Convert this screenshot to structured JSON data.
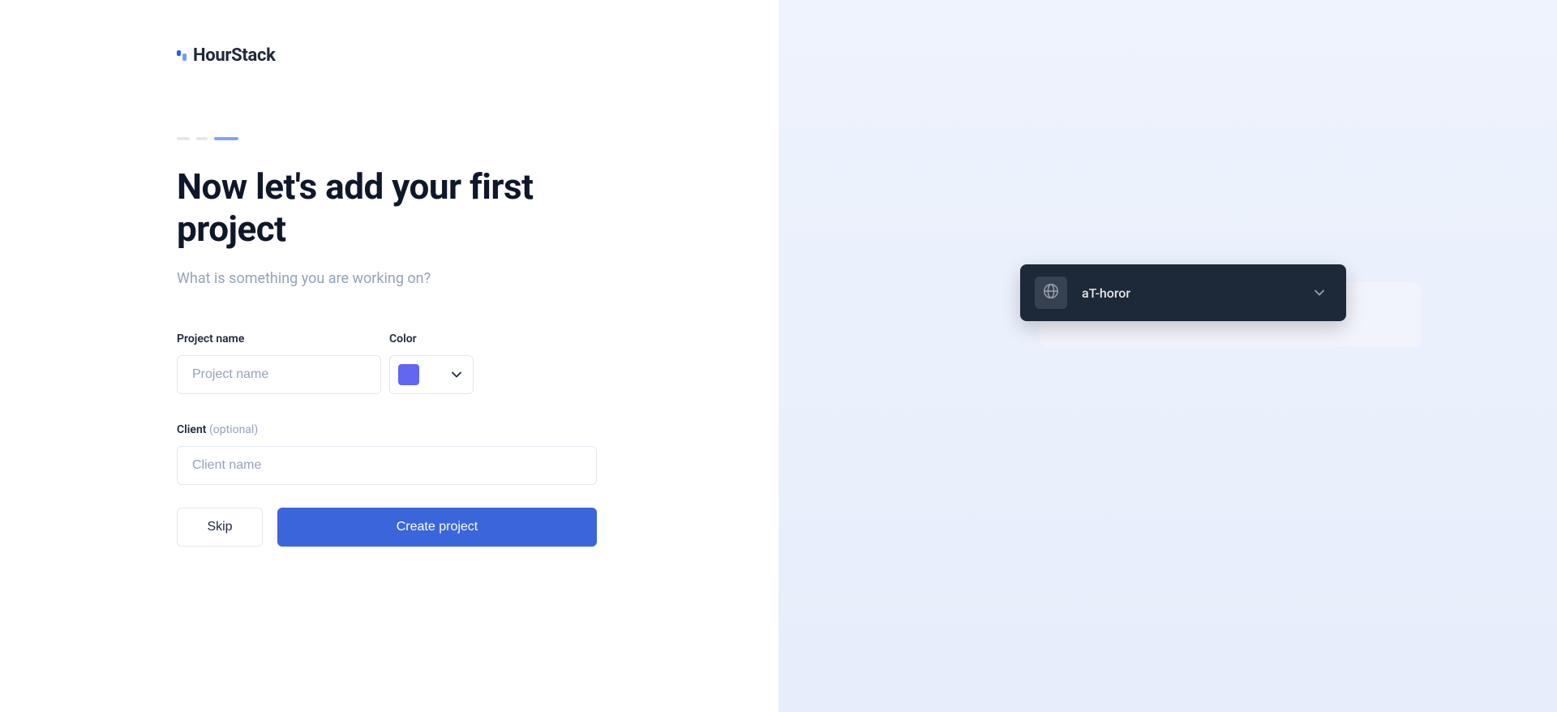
{
  "logo": {
    "text": "HourStack"
  },
  "progress": {
    "steps": 3,
    "current": 3
  },
  "heading": "Now let's add your first project",
  "subheading": "What is something you are working on?",
  "form": {
    "projectName": {
      "label": "Project name",
      "placeholder": "Project name",
      "value": ""
    },
    "color": {
      "label": "Color",
      "value": "#6366f1"
    },
    "client": {
      "label": "Client",
      "optional": "(optional)",
      "placeholder": "Client name",
      "value": ""
    }
  },
  "buttons": {
    "skip": "Skip",
    "create": "Create project"
  },
  "preview": {
    "title": "aT-horor"
  }
}
